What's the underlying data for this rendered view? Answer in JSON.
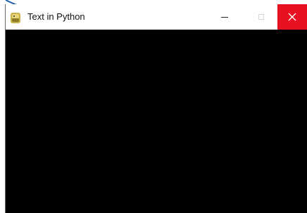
{
  "window": {
    "title": "Text in Python",
    "app_icon": "python-icon",
    "controls": {
      "minimize_icon": "minimize-icon",
      "maximize_icon": "maximize-icon",
      "close_icon": "close-icon",
      "close_color": "#e81123"
    },
    "client_background": "#000000"
  },
  "pointer": {
    "icon": "pointer-dot-icon",
    "color": "#1f5fa6"
  }
}
